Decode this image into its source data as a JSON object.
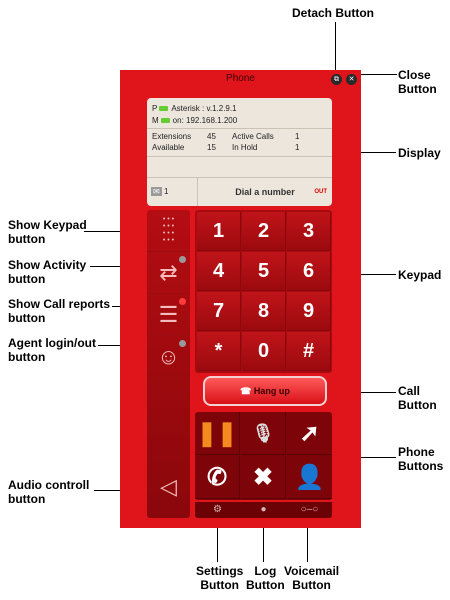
{
  "window": {
    "title": "Phone"
  },
  "display": {
    "p_label": "P",
    "p_text": "Asterisk : v.1.2.9.1",
    "m_label": "M",
    "m_text": "on: 192.168.1.200",
    "stats": {
      "extensions_label": "Extensions",
      "extensions_value": "45",
      "active_calls_label": "Active Calls",
      "active_calls_value": "1",
      "available_label": "Available",
      "available_value": "15",
      "in_hold_label": "In Hold",
      "in_hold_value": "1"
    },
    "messages_count": "1",
    "dial_prompt": "Dial a number",
    "out_label": "OUT"
  },
  "keypad": {
    "keys": [
      "1",
      "2",
      "3",
      "4",
      "5",
      "6",
      "7",
      "8",
      "9",
      "*",
      "0",
      "#"
    ]
  },
  "call_button_label": "Hang up",
  "annotations": {
    "detach": "Detach Button",
    "close": "Close\nButton",
    "display": "Display",
    "keypad": "Keypad",
    "call": "Call\nButton",
    "phone_buttons": "Phone\nButtons",
    "show_keypad": "Show Keypad\nbutton",
    "show_activity": "Show Activity\nbutton",
    "show_call_reports": "Show Call reports\nbutton",
    "agent_login": "Agent login/out\nbutton",
    "audio": "Audio controll\nbutton",
    "settings": "Settings\nButton",
    "log": "Log\nButton",
    "voicemail": "Voicemail\nButton"
  },
  "colors": {
    "phone_red": "#e0141b",
    "keypad_dark": "#a70b10"
  },
  "icons": [
    "detach-icon",
    "close-icon",
    "envelope-icon",
    "keypad-grid-icon",
    "activity-arrows-icon",
    "call-reports-icon",
    "agent-icon",
    "speaker-icon",
    "pause-icon",
    "mute-mic-icon",
    "transfer-arrow-icon",
    "phone-icon",
    "cross-icon",
    "person-icon",
    "gear-icon",
    "chat-icon",
    "voicemail-icon"
  ]
}
